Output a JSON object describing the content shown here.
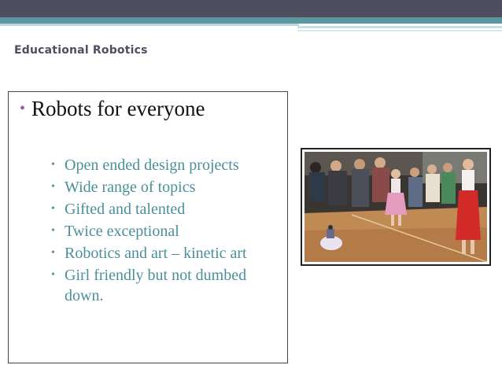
{
  "slide": {
    "title": "Educational Robotics",
    "main_bullet": "Robots for everyone",
    "sub_bullets": [
      "Open ended design projects",
      "Wide range of topics",
      "Gifted and talented",
      "Twice exceptional",
      "Robotics and art – kinetic art",
      "Girl friendly but not dumbed down."
    ]
  },
  "colors": {
    "header_dark": "#4d4f5e",
    "header_teal": "#5a97a0",
    "sub_bullet_text": "#4b8f9b",
    "main_bullet_dot": "#9b5aa6"
  },
  "icons": {
    "main_bullet": "bullet-dot",
    "sub_bullet": "bullet-dot"
  },
  "photo": {
    "subject": "children-dance-robot-photo"
  }
}
